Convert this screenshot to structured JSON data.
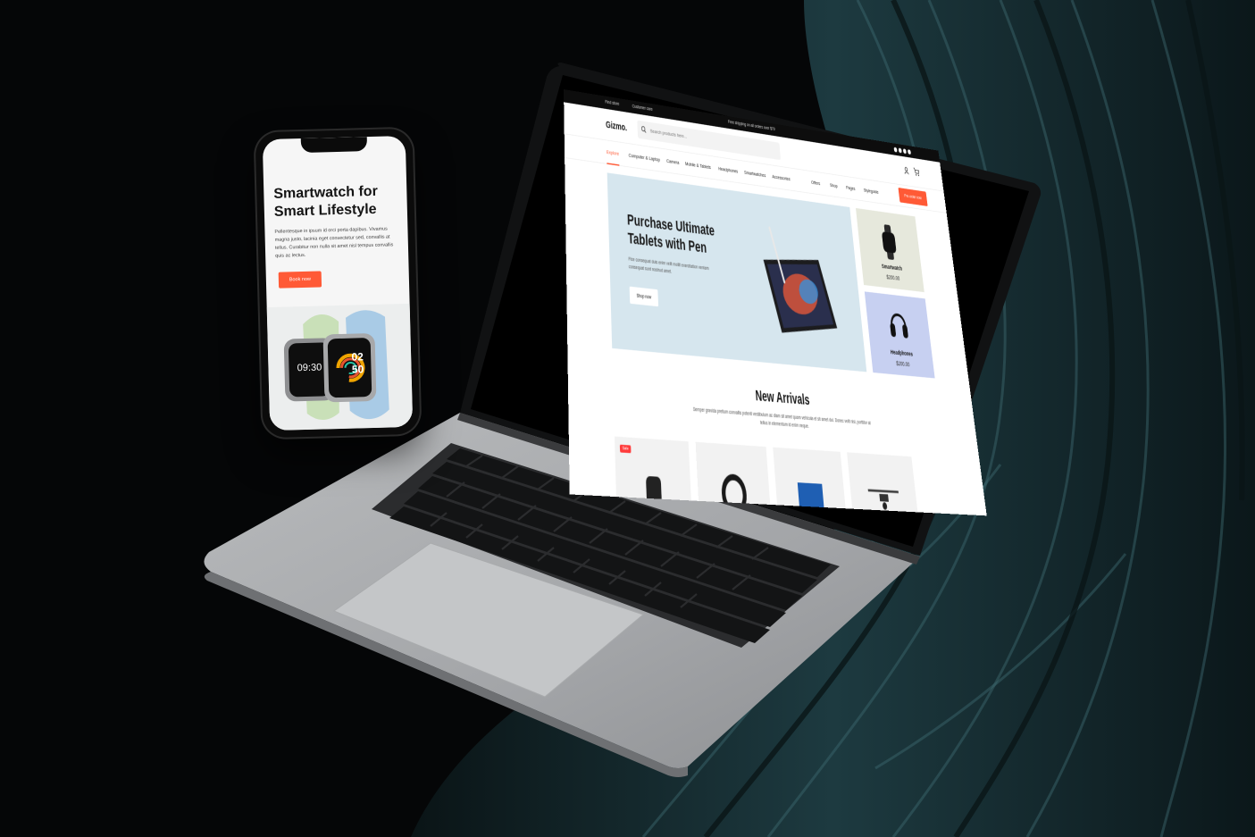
{
  "mobile": {
    "hero_title": "Smartwatch for Smart Lifestyle",
    "hero_text": "Pellentesque in ipsum id orci porta dapibus. Vivamus magna justo, lacinia eget consectetur sed, convallis at tellus. Curabitur non nulla sit amet nisl tempus convallis quis ac lectus.",
    "button": "Book now",
    "watch_time_left": "09:30",
    "watch_time_right_h": "02",
    "watch_time_right_m": "50"
  },
  "site": {
    "topbar": {
      "links": [
        "Find store",
        "Customer care"
      ],
      "shipping": "Free shipping on all orders over $79"
    },
    "logo": "Gizmo.",
    "search_placeholder": "Search products here...",
    "nav": {
      "items": [
        "Explore",
        "Computer & Laptop",
        "Camera",
        "Mobile & Tablets",
        "Headphones",
        "Smartwatches",
        "Accessories"
      ],
      "right": [
        "Offers",
        "Shop",
        "Pages",
        "Styleguide"
      ],
      "preorder": "Pre-order now"
    },
    "hero": {
      "title": "Purchase Ultimate Tablets with Pen",
      "text": "Fice consequat duis enim velit mollit exercitation veniam consequat sunt nostrud amet.",
      "button": "Shop now"
    },
    "side_cards": [
      {
        "name": "Smartwatch",
        "price": "$200.00",
        "bg": "#e6e8dc"
      },
      {
        "name": "Headphones",
        "price": "$200.00",
        "bg": "#c7d0f1"
      }
    ],
    "new_arrivals": {
      "title": "New Arrivals",
      "text": "Semper gravida pretium convallis potenti vestibulum ac diam sit amet quam vehicula et sit amet dui. Donec velit nisi, porttitor at tellus in elementum id enim neque.",
      "badge": "Sale"
    }
  },
  "colors": {
    "accent": "#ff5a36",
    "hero_bg": "#d6e6ee",
    "page_bg": "#050607"
  }
}
